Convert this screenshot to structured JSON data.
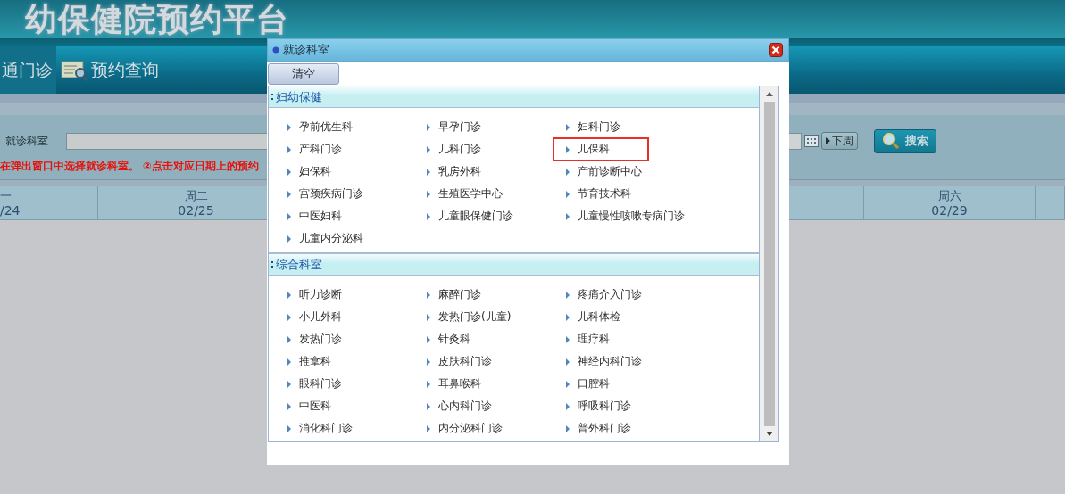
{
  "header": {
    "title": "幼保健院预约平台"
  },
  "nav": [
    {
      "label": "通门诊",
      "selected": true
    },
    {
      "label": "预约查询",
      "selected": false
    }
  ],
  "search": {
    "label": "就诊科室",
    "next_week": "下周",
    "search_button": "搜索"
  },
  "instruction": "在弹出窗口中选择就诊科室。 ②点击对应日期上的预约",
  "week_columns": [
    {
      "day": "一",
      "date": "/24"
    },
    {
      "day": "周二",
      "date": "02/25"
    },
    {
      "day": "周六",
      "date": "02/29"
    }
  ],
  "dialog": {
    "title": "就诊科室",
    "clear_button": "清空",
    "sections": [
      {
        "title": "妇幼保健",
        "items": [
          {
            "label": "孕前优生科",
            "selected": false
          },
          {
            "label": "早孕门诊",
            "selected": false
          },
          {
            "label": "妇科门诊",
            "selected": false
          },
          {
            "label": "产科门诊",
            "selected": false
          },
          {
            "label": "儿科门诊",
            "selected": false
          },
          {
            "label": "儿保科",
            "selected": true
          },
          {
            "label": "妇保科",
            "selected": false
          },
          {
            "label": "乳房外科",
            "selected": false
          },
          {
            "label": "产前诊断中心",
            "selected": false
          },
          {
            "label": "宫颈疾病门诊",
            "selected": false
          },
          {
            "label": "生殖医学中心",
            "selected": false
          },
          {
            "label": "节育技术科",
            "selected": false
          },
          {
            "label": "中医妇科",
            "selected": false
          },
          {
            "label": "儿童眼保健门诊",
            "selected": false
          },
          {
            "label": "儿童慢性咳嗽专病门诊",
            "selected": false
          },
          {
            "label": "儿童内分泌科",
            "selected": false
          }
        ]
      },
      {
        "title": "综合科室",
        "items": [
          {
            "label": "听力诊断",
            "selected": false
          },
          {
            "label": "麻醉门诊",
            "selected": false
          },
          {
            "label": "疼痛介入门诊",
            "selected": false
          },
          {
            "label": "小儿外科",
            "selected": false
          },
          {
            "label": "发热门诊(儿童)",
            "selected": false
          },
          {
            "label": "儿科体检",
            "selected": false
          },
          {
            "label": "发热门诊",
            "selected": false
          },
          {
            "label": "针灸科",
            "selected": false
          },
          {
            "label": "理疗科",
            "selected": false
          },
          {
            "label": "推拿科",
            "selected": false
          },
          {
            "label": "皮肤科门诊",
            "selected": false
          },
          {
            "label": "神经内科门诊",
            "selected": false
          },
          {
            "label": "眼科门诊",
            "selected": false
          },
          {
            "label": "耳鼻喉科",
            "selected": false
          },
          {
            "label": "口腔科",
            "selected": false
          },
          {
            "label": "中医科",
            "selected": false
          },
          {
            "label": "心内科门诊",
            "selected": false
          },
          {
            "label": "呼吸科门诊",
            "selected": false
          },
          {
            "label": "消化科门诊",
            "selected": false
          },
          {
            "label": "内分泌科门诊",
            "selected": false
          },
          {
            "label": "普外科门诊",
            "selected": false
          }
        ]
      }
    ]
  }
}
